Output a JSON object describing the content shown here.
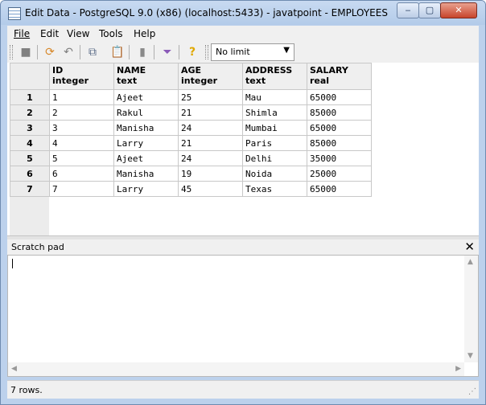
{
  "window": {
    "title": "Edit Data - PostgreSQL 9.0 (x86) (localhost:5433) - javatpoint - EMPLOYEES",
    "minimize_glyph": "‒",
    "maximize_glyph": "▢",
    "close_glyph": "✕"
  },
  "menu": [
    "File",
    "Edit",
    "View",
    "Tools",
    "Help"
  ],
  "toolbar": {
    "icons": [
      "save-icon",
      "refresh-icon",
      "undo-icon",
      "copy-icon",
      "paste-icon",
      "delete-icon",
      "filter-icon",
      "help-icon"
    ],
    "limit_value": "No limit",
    "limit_arrow": "▼"
  },
  "grid": {
    "columns": [
      {
        "name": "ID",
        "type": "integer"
      },
      {
        "name": "NAME",
        "type": "text"
      },
      {
        "name": "AGE",
        "type": "integer"
      },
      {
        "name": "ADDRESS",
        "type": "text"
      },
      {
        "name": "SALARY",
        "type": "real"
      }
    ],
    "rows": [
      {
        "n": "1",
        "cells": [
          "1",
          "Ajeet",
          "25",
          "Mau",
          "65000"
        ]
      },
      {
        "n": "2",
        "cells": [
          "2",
          "Rakul",
          "21",
          "Shimla",
          "85000"
        ]
      },
      {
        "n": "3",
        "cells": [
          "3",
          "Manisha",
          "24",
          "Mumbai",
          "65000"
        ]
      },
      {
        "n": "4",
        "cells": [
          "4",
          "Larry",
          "21",
          "Paris",
          "85000"
        ]
      },
      {
        "n": "5",
        "cells": [
          "5",
          "Ajeet",
          "24",
          "Delhi",
          "35000"
        ]
      },
      {
        "n": "6",
        "cells": [
          "6",
          "Manisha",
          "19",
          "Noida",
          "25000"
        ]
      },
      {
        "n": "7",
        "cells": [
          "7",
          "Larry",
          "45",
          "Texas",
          "65000"
        ]
      }
    ]
  },
  "scratch": {
    "title": "Scratch pad",
    "close": "✕"
  },
  "status": {
    "text": "7 rows."
  }
}
